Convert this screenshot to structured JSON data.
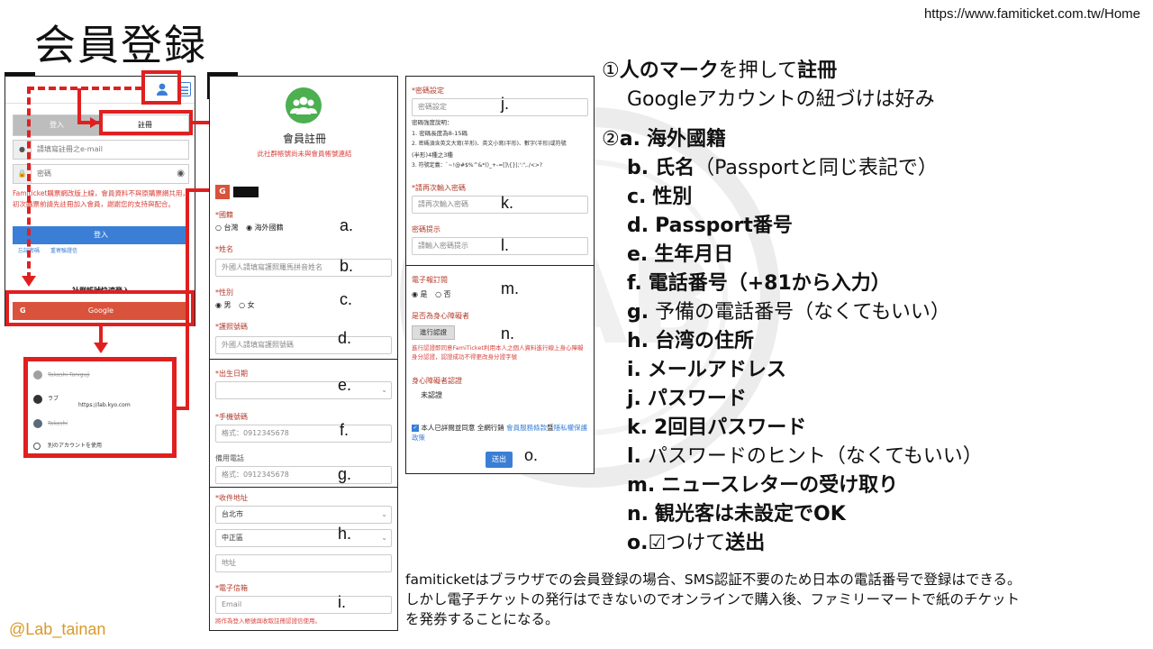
{
  "title": "会員登録",
  "url": "https://www.famiticket.com.tw/Home",
  "credit": "@Lab_tainan",
  "steps": {
    "one": "①",
    "two": "②"
  },
  "panel1": {
    "tab_login": "登入",
    "tab_register": "註冊",
    "email_placeholder": "請填寫註冊之e-mail",
    "password_placeholder": "密碼",
    "notice": "Famiticket購票網改版上線，會員資料不與原購票網共用，初次購票前請先註冊加入會員，謝謝您的支持與配合。",
    "login_button": "登入",
    "link_forgot": "忘記密碼",
    "link_resend": "重寄驗證信",
    "social_heading": "社群帳號快速登入",
    "google_button": "Google"
  },
  "accounts": {
    "rows": [
      {
        "name": "Takashi Taniguji"
      },
      {
        "name": "ラブ",
        "detail": "https://lab.kyo.com"
      },
      {
        "name": "Takashi"
      }
    ],
    "other": "別のアカウントを使用"
  },
  "panel2": {
    "heading": "會員註冊",
    "subtitle": "此社群帳號尚未與會員帳號連結",
    "nationality_label": "*國籍",
    "nat_taiwan": "台灣",
    "nat_foreign": "海外國籍",
    "name_label": "*姓名",
    "name_placeholder": "外國人請填寫護照羅馬拼音姓名",
    "gender_label": "*性別",
    "gender_male": "男",
    "gender_female": "女",
    "passport_label": "*護照號碼",
    "passport_placeholder": "外國人請填寫護照號碼",
    "birth_label": "*出生日期",
    "phone_label": "*手機號碼",
    "phone_placeholder": "格式：0912345678",
    "backup_label": "備用電話",
    "backup_placeholder": "格式：0912345678",
    "address_label": "*收件地址",
    "city": "台北市",
    "district": "中正區",
    "address_placeholder": "地址",
    "email_label": "*電子信箱",
    "email_placeholder": "Email",
    "email_note": "將作為登入帳號與收取註冊認證信使用。"
  },
  "panel3": {
    "pw_label": "*密碼設定",
    "pw_placeholder": "密碼設定",
    "pw_rules": [
      "密碼強度說明：",
      "1. 密碼長度為8-15碼",
      "2. 密碼須含英文大寫(半形)、英文小寫(半形)、數字(半形)或符號",
      "(半形)4種之3種",
      "3. 符號定義：`~!@#$%^&*()_+-=[]\\{}|;':\",./<>?"
    ],
    "pw2_label": "*請再次輸入密碼",
    "pw2_placeholder": "請再次輸入密碼",
    "hint_label": "密碼提示",
    "hint_placeholder": "請輸入密碼提示",
    "newsletter_label": "電子報訂閱",
    "yes": "是",
    "no": "否",
    "disabled_label": "是否為身心障礙者",
    "verify_button": "進行認證",
    "verify_note": "進行認證即同意FamiTicket利用本人之個人資料進行線上身心障礙身分認證，認證成功不得更改身分證字號",
    "disabled_status_label": "身心障礙者認證",
    "disabled_status": "未認證",
    "agree_text": "本人已詳閱並同意 全網行銷",
    "agree_link1": "會員服務條款",
    "agree_and": "暨",
    "agree_link2": "隱私權保護政策",
    "submit_button": "送出"
  },
  "letters": [
    "a.",
    "b.",
    "c.",
    "d.",
    "e.",
    "f.",
    "g.",
    "h.",
    "i.",
    "j.",
    "k.",
    "l.",
    "m.",
    "n.",
    "o."
  ],
  "instructions": {
    "step1_prefix": "①",
    "step1_bold": "人のマーク",
    "step1_mid": "を押して",
    "step1_bold2": "註冊",
    "step1_sub": "Googleアカウントの紐づけは好み",
    "step2_prefix": "②",
    "items": [
      {
        "key": "a.",
        "text": "海外國籍",
        "bold": true
      },
      {
        "key": "b.",
        "text": "氏名",
        "rest": "（Passportと同じ表記で）",
        "bold": true
      },
      {
        "key": "c.",
        "text": "性別",
        "bold": true
      },
      {
        "key": "d.",
        "text": "Passport番号",
        "bold": true
      },
      {
        "key": "e.",
        "text": "生年月日",
        "bold": true
      },
      {
        "key": "f.",
        "text": "電話番号（+81から入力）",
        "bold": true
      },
      {
        "key": "g.",
        "text": "",
        "rest": "予備の電話番号（なくてもいい）",
        "bold": true
      },
      {
        "key": "h.",
        "text": "台湾の住所",
        "bold": true
      },
      {
        "key": "i.",
        "text": "メールアドレス",
        "bold": true
      },
      {
        "key": "j.",
        "text": "パスワード",
        "bold": true
      },
      {
        "key": "k.",
        "text": "2回目パスワード",
        "bold": true
      },
      {
        "key": "l.",
        "text": "",
        "rest": "パスワードのヒント（なくてもいい）",
        "bold": true
      },
      {
        "key": "m.",
        "text": "ニュースレターの受け取り",
        "bold": true
      },
      {
        "key": "n.",
        "text": "観光客は未設定でOK",
        "bold": true
      },
      {
        "key": "o.",
        "text": "☑",
        "rest": "つけて",
        "tail": "送出",
        "bold": true
      }
    ]
  },
  "footnote": [
    "famiticketはブラウザでの会員登録の場合、SMS認証不要のため日本の電話番号で登録はできる。",
    "しかし電子チケットの発行はできないのでオンラインで購入後、ファミリーマートで紙のチケット",
    "を発券することになる。"
  ],
  "colors": {
    "accent_red": "#e02020",
    "primary_blue": "#3a7fd5",
    "google_red": "#d9533c",
    "green": "#4caf50",
    "credit_orange": "#d89a2a"
  }
}
